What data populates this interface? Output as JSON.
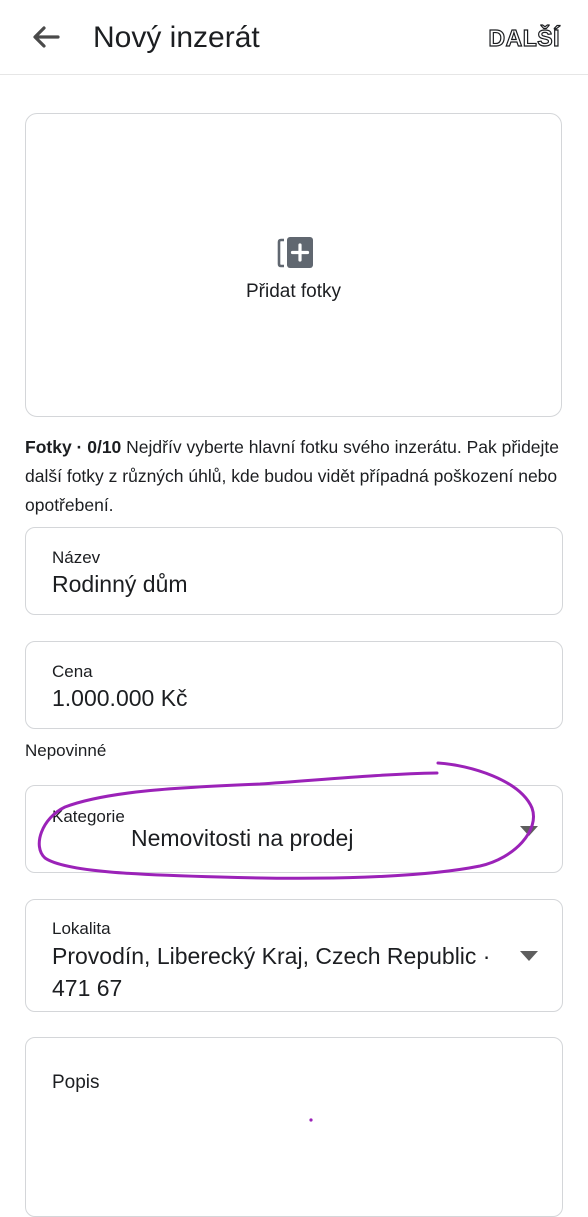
{
  "header": {
    "title": "Nový inzerát",
    "next_label": "DALŠÍ"
  },
  "photos": {
    "add_label": "Přidat fotky",
    "note_prefix": "Fotky · 0/10",
    "note_text": " Nejdřív vyberte hlavní fotku svého inzerátu. Pak přidejte další fotky z různých úhlů, kde budou vidět případná poškození nebo opotřebení."
  },
  "fields": {
    "name": {
      "label": "Název",
      "value": "Rodinný dům"
    },
    "price": {
      "label": "Cena",
      "value": "1.000.000 Kč"
    },
    "optional_label": "Nepovinné",
    "category": {
      "label": "Kategorie",
      "value": "Nemovitosti na prodej"
    },
    "location": {
      "label": "Lokalita",
      "value": "Provodín, Liberecký Kraj, Czech Republic · 471 67"
    },
    "description": {
      "label": "Popis",
      "value": ""
    }
  },
  "colors": {
    "annotation": "#9b22b8",
    "border": "#d4d6d9",
    "text": "#1c1e21"
  },
  "icons": {
    "back": "arrow-left-icon",
    "add_photo": "add-photo-icon",
    "dropdown": "caret-down-icon"
  }
}
